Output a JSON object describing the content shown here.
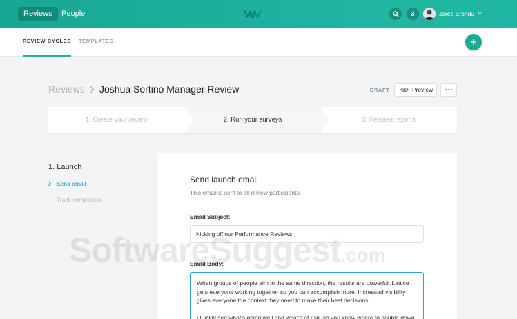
{
  "topbar": {
    "nav": [
      {
        "label": "Reviews",
        "active": true
      },
      {
        "label": "People",
        "active": false
      }
    ],
    "logo_icon": "lattice-logo-icon",
    "search_icon": "search-icon",
    "notification_count": "3",
    "user_name": "Jared Erondu",
    "user_menu_icon": "chevron-down-icon"
  },
  "subnav": {
    "tabs": [
      {
        "label": "REVIEW CYCLES",
        "active": true
      },
      {
        "label": "TEMPLATES",
        "active": false
      }
    ],
    "add_icon": "plus-icon"
  },
  "header": {
    "breadcrumb_root": "Reviews",
    "title": "Joshua Sortino Manager Review",
    "status": "DRAFT",
    "preview_label": "Preview",
    "more_icon": "ellipsis-icon"
  },
  "stepper": {
    "steps": [
      {
        "label": "1. Create your review",
        "state": "inactive"
      },
      {
        "label": "2. Run your surveys",
        "state": "active"
      },
      {
        "label": "3. Release reports",
        "state": "inactive"
      }
    ]
  },
  "sidebar": {
    "section_title": "1. Launch",
    "items": [
      {
        "label": "Send email",
        "active": true
      },
      {
        "label": "Track completion",
        "active": false
      }
    ]
  },
  "card": {
    "title": "Send launch email",
    "subtitle": "This email is sent to all review participants.",
    "subject_label": "Email Subject:",
    "subject_value": "Kicking off our Performance Reviews!",
    "body_label": "Email Body:",
    "body_value": "When groups of people aim in the same direction, the results are powerful. Lattice gets everyone working together so you can accomplish more. Increased visibility gives everyone the context they need to make their best decisions.\n\nQuickly see what's going well and what's at risk, so you know where to double down"
  },
  "watermark": {
    "main": "SoftwareSuggest",
    "suffix": ".com"
  },
  "colors": {
    "brand_teal": "#1fb4a0",
    "link_blue": "#1a8fd0",
    "focus_blue": "#2ea0dc"
  }
}
